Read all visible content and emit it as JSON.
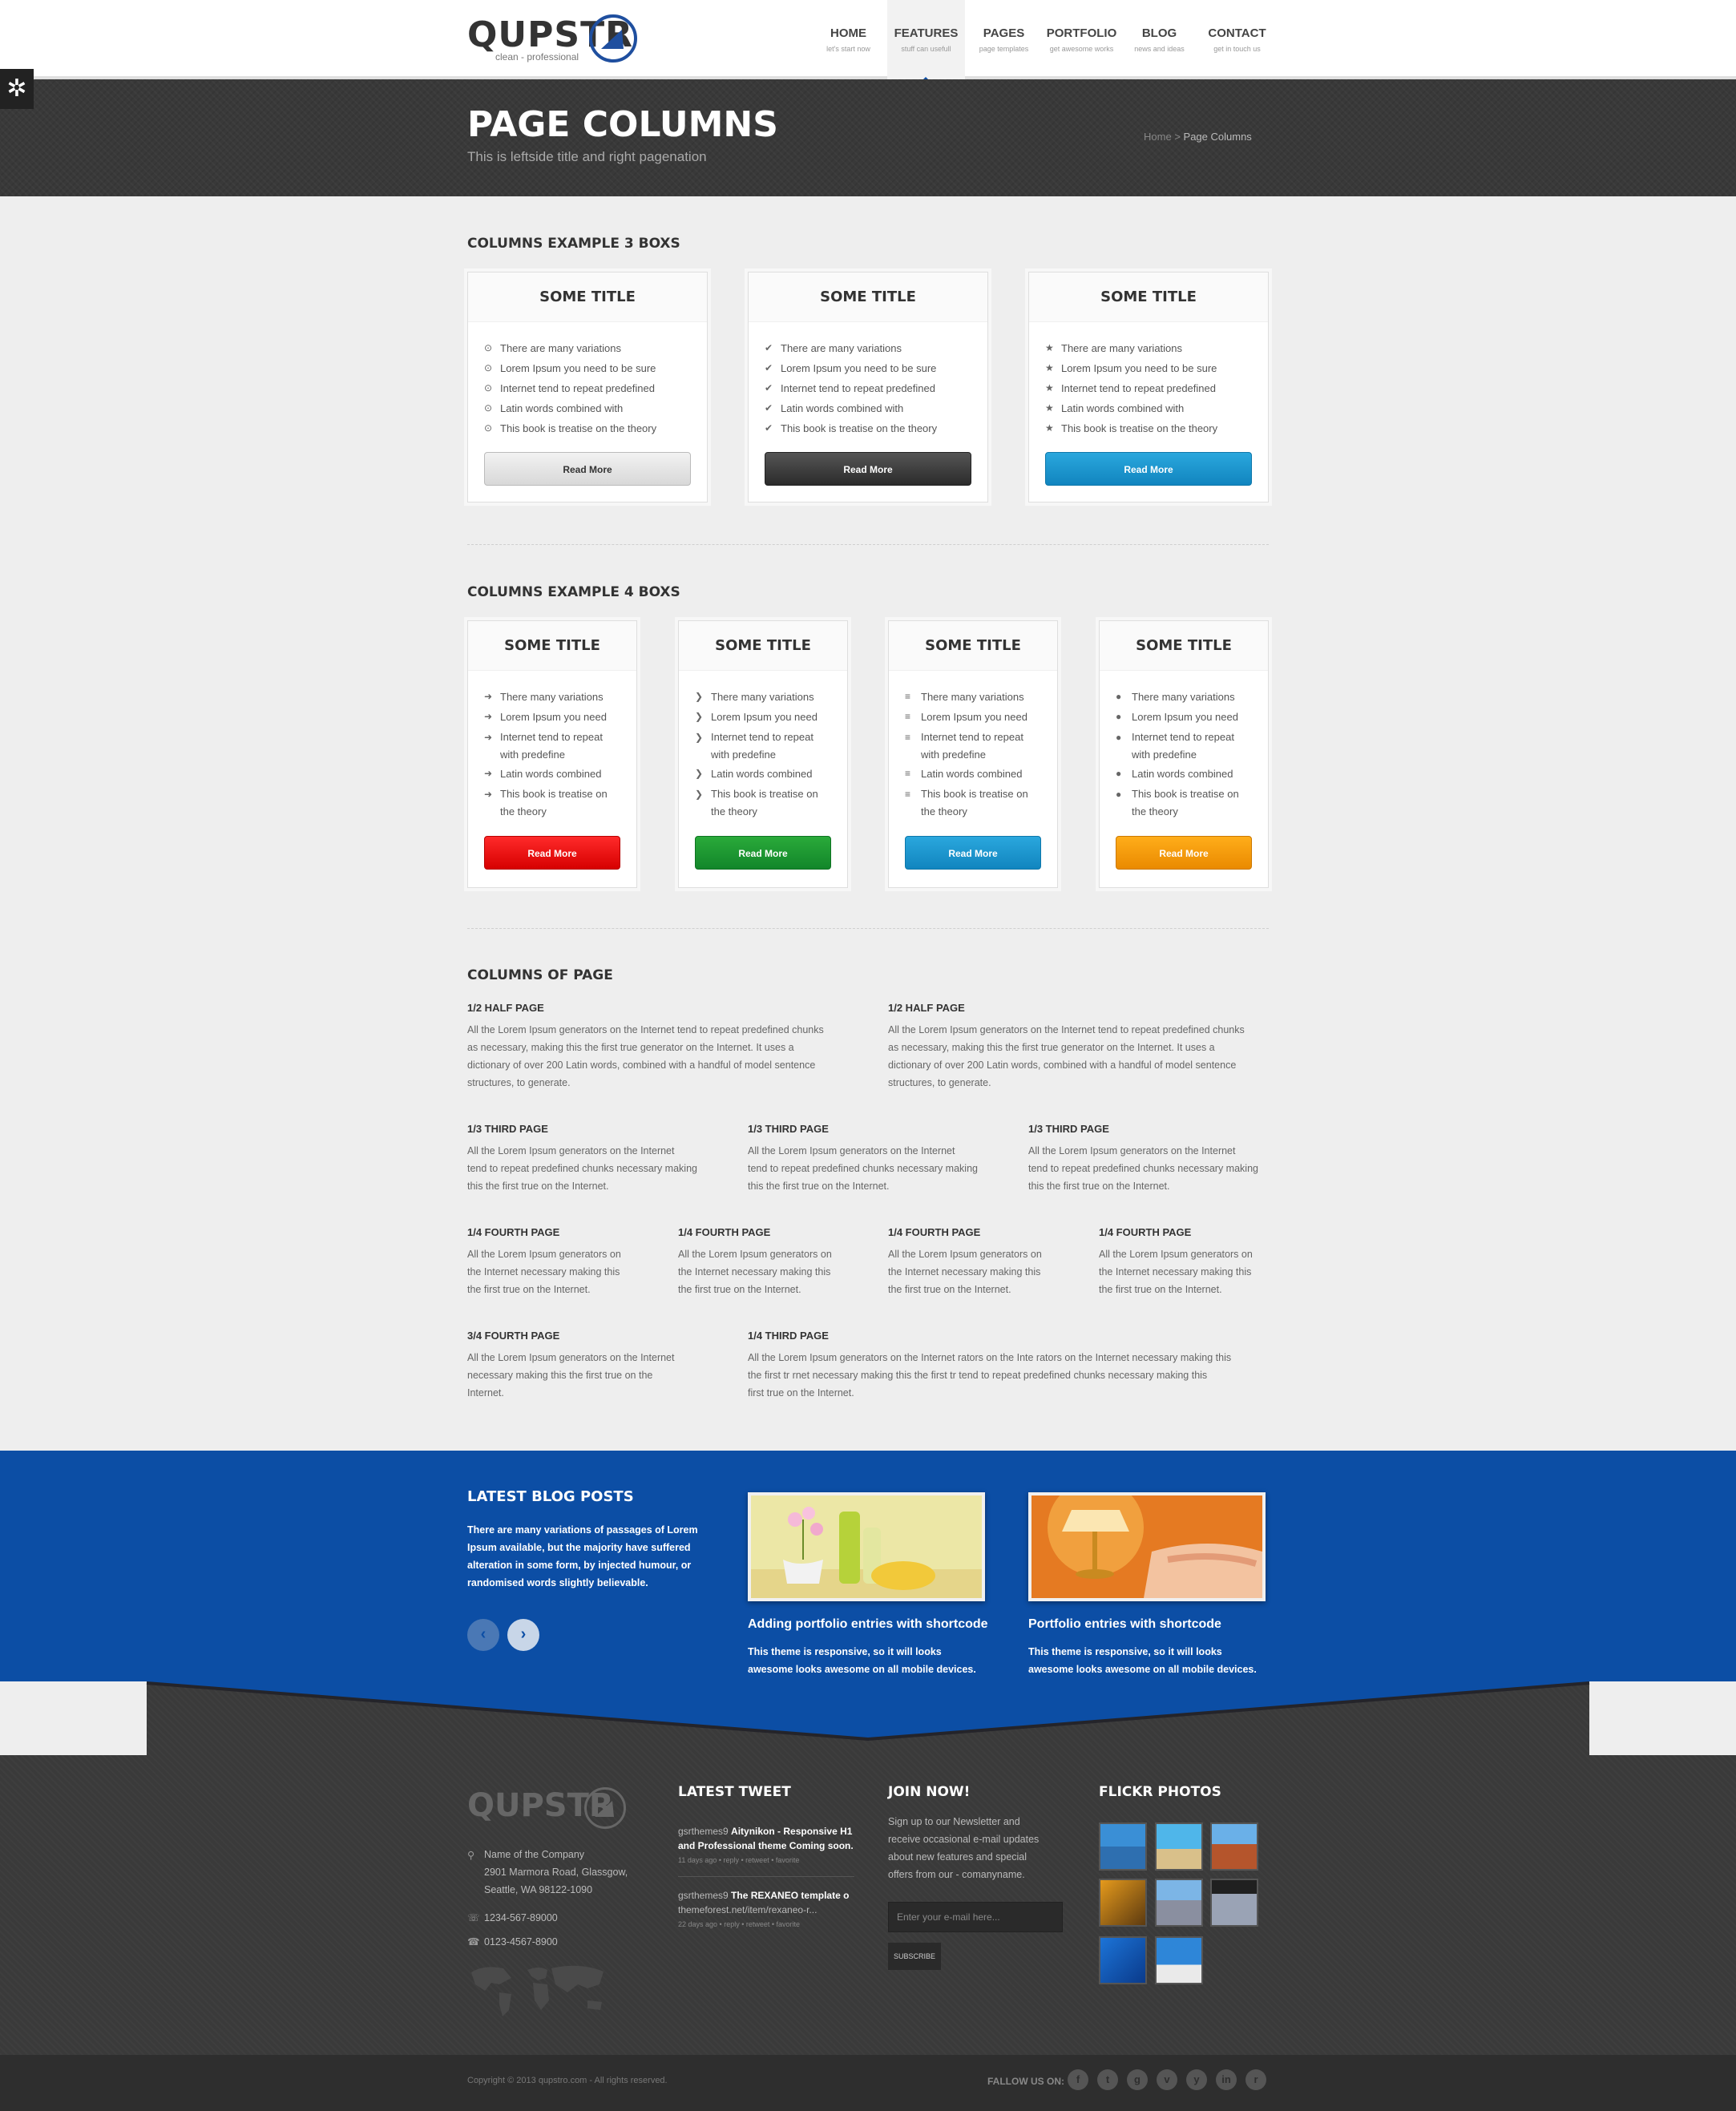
{
  "brand": {
    "name": "QUPSTR",
    "tagline": "clean - professional"
  },
  "nav": [
    {
      "label": "HOME",
      "sub": "let's start now"
    },
    {
      "label": "FEATURES",
      "sub": "stuff can usefull"
    },
    {
      "label": "PAGES",
      "sub": "page templates"
    },
    {
      "label": "PORTFOLIO",
      "sub": "get awesome works"
    },
    {
      "label": "BLOG",
      "sub": "news and ideas"
    },
    {
      "label": "CONTACT",
      "sub": "get in touch us"
    }
  ],
  "title_band": {
    "title": "PAGE COLUMNS",
    "subtitle": "This is leftside title and right pagenation",
    "breadcrumb_home": "Home",
    "breadcrumb_sep": ">",
    "breadcrumb_current": "Page Columns"
  },
  "three_boxes": {
    "heading": "COLUMNS EXAMPLE 3 BOXS",
    "boxes": [
      {
        "title": "SOME TITLE",
        "icon": "circle-check-icon",
        "items": [
          "There are many variations",
          "Lorem Ipsum you need to be sure",
          "Internet tend to repeat predefined",
          "Latin words combined with",
          "This book is treatise on the theory"
        ],
        "button": "Read More"
      },
      {
        "title": "SOME TITLE",
        "icon": "check-icon",
        "items": [
          "There are many variations",
          "Lorem Ipsum you need to be sure",
          "Internet tend to repeat predefined",
          "Latin words combined with",
          "This book is treatise on the theory"
        ],
        "button": "Read More"
      },
      {
        "title": "SOME TITLE",
        "icon": "star-icon",
        "items": [
          "There are many variations",
          "Lorem Ipsum you need to be sure",
          "Internet tend to repeat predefined",
          "Latin words combined with",
          "This book is treatise on the theory"
        ],
        "button": "Read More"
      }
    ]
  },
  "four_boxes": {
    "heading": "COLUMNS EXAMPLE 4 BOXS",
    "boxes": [
      {
        "title": "SOME TITLE",
        "icon": "arrow-right-icon",
        "items": [
          "There many variations",
          "Lorem Ipsum you need",
          "Internet tend to repeat",
          "with predefine",
          "Latin words combined",
          "This book is treatise on",
          "the theory"
        ],
        "button": "Read More"
      },
      {
        "title": "SOME TITLE",
        "icon": "chevron-right-icon",
        "items": [
          "There many variations",
          "Lorem Ipsum you need",
          "Internet tend to repeat",
          "with predefine",
          "Latin words combined",
          "This book is treatise on",
          "the theory"
        ],
        "button": "Read More"
      },
      {
        "title": "SOME TITLE",
        "icon": "filter-icon",
        "items": [
          "There many variations",
          "Lorem Ipsum you need",
          "Internet tend to repeat",
          "with predefine",
          "Latin words combined",
          "This book is treatise on",
          "the theory"
        ],
        "button": "Read More"
      },
      {
        "title": "SOME TITLE",
        "icon": "user-icon",
        "items": [
          "There many variations",
          "Lorem Ipsum you need",
          "Internet tend to repeat",
          "with predefine",
          "Latin words combined",
          "This book is treatise on",
          "the theory"
        ],
        "button": "Read More"
      }
    ]
  },
  "columns_page": {
    "heading": "COLUMNS OF PAGE",
    "half": [
      {
        "title": "1/2 HALF PAGE",
        "lines": [
          "All the Lorem Ipsum generators on the Internet tend to repeat predefined chunks",
          "as necessary, making this the first true generator on the Internet. It uses a",
          "dictionary of over 200 Latin words, combined with a handful of model sentence",
          "structures, to generate."
        ]
      },
      {
        "title": "1/2 HALF PAGE",
        "lines": [
          "All the Lorem Ipsum generators on the Internet tend to repeat predefined chunks",
          "as necessary, making this the first true generator on the Internet. It uses a",
          "dictionary of over 200 Latin words, combined with a handful of model sentence",
          "structures, to generate."
        ]
      }
    ],
    "third": [
      {
        "title": "1/3 THIRD PAGE",
        "lines": [
          "All the Lorem Ipsum generators on the Internet",
          "tend to repeat predefined chunks necessary making",
          "this the first true on the Internet."
        ]
      },
      {
        "title": "1/3 THIRD PAGE",
        "lines": [
          "All the Lorem Ipsum generators on the Internet",
          "tend to repeat predefined chunks necessary making",
          "this the first true on the Internet."
        ]
      },
      {
        "title": "1/3 THIRD PAGE",
        "lines": [
          "All the Lorem Ipsum generators on the Internet",
          "tend to repeat predefined chunks necessary making",
          "this the first true on the Internet."
        ]
      }
    ],
    "fourth": [
      {
        "title": "1/4 FOURTH PAGE",
        "lines": [
          "All the Lorem Ipsum generators on",
          "the Internet necessary making this",
          "the first true on the Internet."
        ]
      },
      {
        "title": "1/4 FOURTH PAGE",
        "lines": [
          "All the Lorem Ipsum generators on",
          "the Internet necessary making this",
          "the first true on the Internet."
        ]
      },
      {
        "title": "1/4 FOURTH PAGE",
        "lines": [
          "All the Lorem Ipsum generators on",
          "the Internet necessary making this",
          "the first true on the Internet."
        ]
      },
      {
        "title": "1/4 FOURTH PAGE",
        "lines": [
          "All the Lorem Ipsum generators on",
          "the Internet necessary making this",
          "the first true on the Internet."
        ]
      }
    ],
    "mixed": [
      {
        "title": "3/4 FOURTH PAGE",
        "lines": [
          "All the Lorem Ipsum generators on the Internet",
          "necessary making this the first true on the",
          "Internet."
        ]
      },
      {
        "title": "1/4 THIRD PAGE",
        "lines": [
          "All the Lorem Ipsum generators on the Internet rators on the Inte rators on the Internet necessary making this",
          "the first tr rnet necessary making this the first tr tend to repeat predefined chunks necessary making this",
          "first true on the Internet."
        ]
      }
    ]
  },
  "blog": {
    "heading": "LATEST BLOG POSTS",
    "intro": "There are many variations of passages of Lorem Ipsum available, but the majority have suffered alteration in some form, by injected humour, or randomised words slightly believable.",
    "prev": "‹",
    "next": "›",
    "posts": [
      {
        "title": "Adding portfolio entries with shortcode",
        "text": "This theme is responsive, so it will looks awesome looks awesome on all mobile devices."
      },
      {
        "title": "Portfolio entries with shortcode",
        "text": "This theme is responsive, so it will looks awesome looks awesome on all mobile devices."
      }
    ]
  },
  "footer": {
    "company": "Name of the Company",
    "address1": "2901 Marmora Road, Glassgow,",
    "address2": "Seattle, WA 98122-1090",
    "phone": "1234-567-89000",
    "fax": "0123-4567-8900",
    "tweet_heading": "LATEST TWEET",
    "tweets": [
      {
        "user": "gsrthemes9",
        "line1": "Aitynikon - Responsive H1",
        "line2": "and Professional theme Coming soon.",
        "meta": "11 days ago • reply • retweet • favorite"
      },
      {
        "user": "gsrthemes9",
        "line1": "The REXANEO template o",
        "line2": "themeforest.net/item/rexaneo-r...",
        "meta": "22 days ago • reply • retweet • favorite"
      }
    ],
    "join_heading": "JOIN NOW!",
    "join_lines": [
      "Sign up to our Newsletter and",
      "receive occasional e-mail updates",
      "about new features and special",
      "offers from our - comanyname."
    ],
    "email_placeholder": "Enter your e-mail here...",
    "subscribe": "SUBSCRIBE",
    "flickr_heading": "FLICKR PHOTOS",
    "copyright": "Copyright © 2013 qupstro.com - All rights reserved.",
    "follow": "FALLOW US ON:",
    "social": [
      {
        "icon": "facebook-icon",
        "glyph": "f"
      },
      {
        "icon": "twitter-icon",
        "glyph": "t"
      },
      {
        "icon": "google-plus-icon",
        "glyph": "g"
      },
      {
        "icon": "vimeo-icon",
        "glyph": "v"
      },
      {
        "icon": "youtube-icon",
        "glyph": "y"
      },
      {
        "icon": "linkedin-icon",
        "glyph": "in"
      },
      {
        "icon": "rss-icon",
        "glyph": "r"
      }
    ]
  },
  "colors": {
    "brand_blue": "#0c4ea5",
    "dark": "#393939",
    "red": "#e00000",
    "green": "#1a9a32",
    "sky": "#1b96cf",
    "orange": "#f39a0c"
  }
}
